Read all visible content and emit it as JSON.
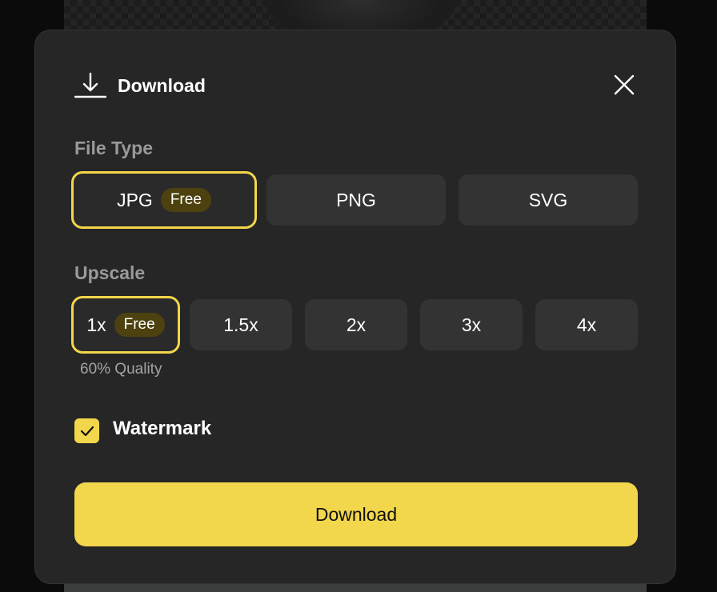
{
  "dialog": {
    "title": "Download",
    "icons": {
      "header": "download-icon",
      "close": "close-icon",
      "check": "checkmark-icon"
    }
  },
  "file_type": {
    "label": "File Type",
    "selected": "JPG",
    "options": [
      {
        "label": "JPG",
        "badge": "Free"
      },
      {
        "label": "PNG"
      },
      {
        "label": "SVG"
      }
    ]
  },
  "upscale": {
    "label": "Upscale",
    "selected": "1x",
    "options": [
      {
        "label": "1x",
        "badge": "Free"
      },
      {
        "label": "1.5x"
      },
      {
        "label": "2x"
      },
      {
        "label": "3x"
      },
      {
        "label": "4x"
      }
    ],
    "quality_note": "60% Quality"
  },
  "watermark": {
    "label": "Watermark",
    "checked": true
  },
  "actions": {
    "download_label": "Download"
  },
  "colors": {
    "accent": "#f2d64b",
    "badge_bg": "#4d420f",
    "dialog_bg": "#262626",
    "option_bg": "#333333"
  }
}
